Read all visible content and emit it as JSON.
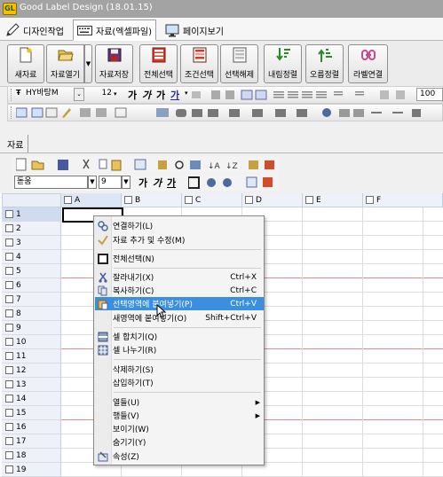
{
  "window": {
    "title": "Good Label Design (18.01.15)",
    "app_badge": "GL"
  },
  "mode_tabs": [
    {
      "label": "디자인작업",
      "icon": "pencil-icon",
      "active": false
    },
    {
      "label": "자료(엑셀파일)",
      "icon": "keyboard-icon",
      "active": true
    },
    {
      "label": "페이지보기",
      "icon": "monitor-icon",
      "active": false
    }
  ],
  "ribbon": {
    "new_data": "새자료",
    "open_data": "자료열기",
    "save_data": "자료저장",
    "select_all": "전체선택",
    "condition_select": "조건선택",
    "deselect": "선택해제",
    "sort_desc": "내림정렬",
    "sort_asc": "오름정렬",
    "label_link": "라벨연결"
  },
  "format_bar": {
    "font": "HY바탕M",
    "size": "12",
    "zoom": "100"
  },
  "doc_tab": {
    "label": "자료"
  },
  "sheet_bar": {
    "font": "돋움",
    "size": "9",
    "bold": "가",
    "italic": "가",
    "underline": "가"
  },
  "grid": {
    "columns": [
      "A",
      "B",
      "C",
      "D",
      "E",
      "F"
    ],
    "rows": [
      "1",
      "2",
      "3",
      "4",
      "5",
      "6",
      "7",
      "8",
      "9",
      "10",
      "11",
      "12",
      "13",
      "14",
      "15",
      "16",
      "17",
      "18",
      "19"
    ]
  },
  "context_menu": {
    "items": [
      {
        "label": "연결하기(L)",
        "icon": "link-icon",
        "shortcut": ""
      },
      {
        "label": "자료 추가 및 수정(M)",
        "icon": "checkmark-icon",
        "shortcut": ""
      },
      {
        "label": "전체선택(N)",
        "icon": "select-all-icon",
        "shortcut": ""
      },
      {
        "label": "잘라내기(X)",
        "icon": "cut-icon",
        "shortcut": "Ctrl+X"
      },
      {
        "label": "복사하기(C)",
        "icon": "copy-icon",
        "shortcut": "Ctrl+C"
      },
      {
        "label": "선택영역에 붙여넣기(P)",
        "icon": "paste-icon",
        "shortcut": "Ctrl+V"
      },
      {
        "label": "새영역에 붙여넣기(O)",
        "icon": "",
        "shortcut": "Shift+Ctrl+V"
      },
      {
        "label": "셀 합치기(Q)",
        "icon": "merge-cells-icon",
        "shortcut": ""
      },
      {
        "label": "셀 나누기(R)",
        "icon": "split-cells-icon",
        "shortcut": ""
      },
      {
        "label": "삭제하기(S)",
        "icon": "",
        "shortcut": ""
      },
      {
        "label": "삽입하기(T)",
        "icon": "",
        "shortcut": ""
      },
      {
        "label": "열들(U)",
        "icon": "",
        "shortcut": ""
      },
      {
        "label": "행들(V)",
        "icon": "",
        "shortcut": ""
      },
      {
        "label": "보이기(W)",
        "icon": "",
        "shortcut": ""
      },
      {
        "label": "숨기기(Y)",
        "icon": "",
        "shortcut": ""
      },
      {
        "label": "속성(Z)",
        "icon": "properties-icon",
        "shortcut": ""
      }
    ]
  },
  "colors": {
    "accent": "#3a8fe0",
    "titlebar": "#a3a3a3",
    "page_break": "#e38b8b"
  }
}
